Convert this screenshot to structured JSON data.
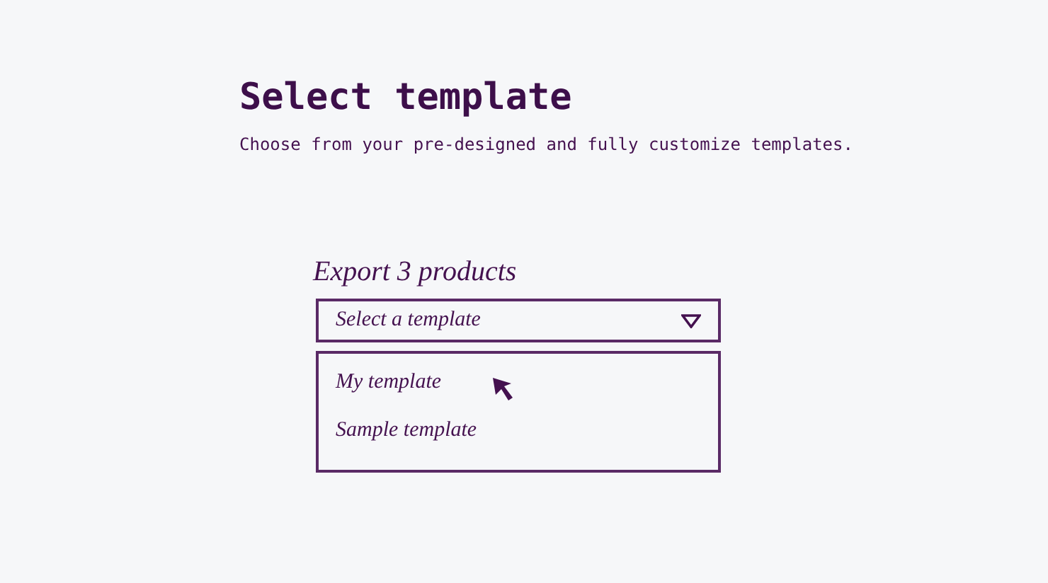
{
  "title": "Select template",
  "subtitle": "Choose from your pre-designed and fully customize templates.",
  "field": {
    "label": "Export 3 products",
    "placeholder": "Select a template",
    "expanded": true
  },
  "options": [
    {
      "label": "My template"
    },
    {
      "label": "Sample template"
    }
  ]
}
